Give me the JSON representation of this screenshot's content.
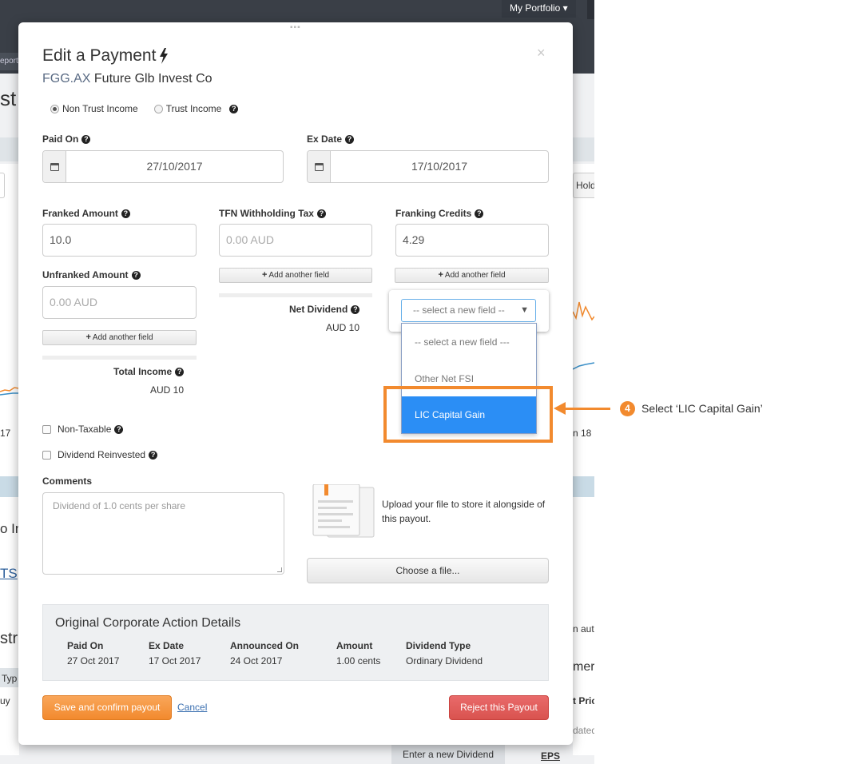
{
  "background": {
    "portfolio_menu": "My Portfolio ▾",
    "tab_fragment": "eport",
    "title_fragment": "st",
    "hold_fragment": "Hold",
    "axis_left_fragment": "17",
    "axis_right_fragment": "n 18",
    "left_text_1": "o In",
    "left_text_2": "TS",
    "left_text_3": "str",
    "left_text_4": "Typ",
    "left_text_5": "uy",
    "right_text_1": "n auto",
    "right_text_2": "mer",
    "right_text_3": "t Pric",
    "right_text_4": "dated",
    "right_text_5": "EPS",
    "enter_dividend": "Enter a new Dividend"
  },
  "modal": {
    "drag_glyph": "▪▪▪",
    "close": "×",
    "title": "Edit a Payment",
    "ticker": "FGG.AX",
    "company": "Future Glb Invest Co",
    "income_type": {
      "options": [
        "Non Trust Income",
        "Trust Income"
      ],
      "selected": "Non Trust Income"
    },
    "paid_on": {
      "label": "Paid On",
      "value": "27/10/2017"
    },
    "ex_date": {
      "label": "Ex Date",
      "value": "17/10/2017"
    },
    "franked_amount": {
      "label": "Franked Amount",
      "value": "10.0"
    },
    "tfn_withholding": {
      "label": "TFN Withholding Tax",
      "placeholder": "0.00 AUD"
    },
    "franking_credits": {
      "label": "Franking Credits",
      "value": "4.29"
    },
    "unfranked_amount": {
      "label": "Unfranked Amount",
      "placeholder": "0.00 AUD"
    },
    "add_field_label": "Add another field",
    "net_dividend": {
      "label": "Net Dividend",
      "value": "AUD 10"
    },
    "total_income": {
      "label": "Total Income",
      "value": "AUD 10"
    },
    "new_field_select": {
      "selected": "-- select a new field --",
      "options": [
        "-- select a new field ---",
        "Other Net FSI",
        "LIC Capital Gain"
      ],
      "highlighted": "LIC Capital Gain"
    },
    "non_taxable": "Non-Taxable",
    "dividend_reinvested": "Dividend Reinvested",
    "comments": {
      "label": "Comments",
      "placeholder": "Dividend of 1.0 cents per share"
    },
    "upload_text": "Upload your file to store it alongside of this payout.",
    "choose_file": "Choose a file...",
    "original": {
      "title": "Original Corporate Action Details",
      "columns": [
        {
          "header": "Paid On",
          "value": "27 Oct 2017"
        },
        {
          "header": "Ex Date",
          "value": "17 Oct 2017"
        },
        {
          "header": "Announced On",
          "value": "24 Oct 2017"
        },
        {
          "header": "Amount",
          "value": "1.00 cents"
        },
        {
          "header": "Dividend Type",
          "value": "Ordinary Dividend"
        }
      ]
    },
    "save_button": "Save and confirm payout",
    "cancel_link": "Cancel",
    "reject_button": "Reject this Payout"
  },
  "annotation": {
    "step_number": "4",
    "step_text": "Select ‘LIC Capital Gain’",
    "accent_color": "#f28a2e"
  }
}
